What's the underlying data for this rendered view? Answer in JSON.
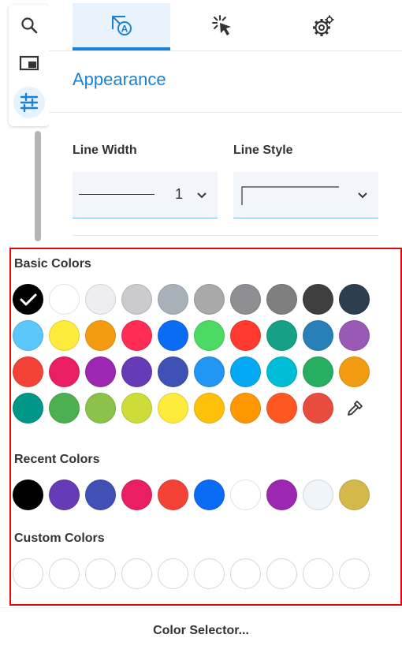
{
  "tabs": [
    {
      "name": "tab-appearance",
      "icon": "shape-text-icon",
      "active": true
    },
    {
      "name": "tab-interaction",
      "icon": "cursor-click-icon",
      "active": false
    },
    {
      "name": "tab-settings",
      "icon": "gear-icon",
      "active": false
    }
  ],
  "rail": [
    "search-icon",
    "panel-icon",
    "sliders-icon"
  ],
  "appearance": {
    "title": "Appearance",
    "line_width_label": "Line Width",
    "line_width_value": "1",
    "line_style_label": "Line Style"
  },
  "picker": {
    "basic_label": "Basic Colors",
    "recent_label": "Recent Colors",
    "custom_label": "Custom Colors",
    "basic_colors": [
      [
        "#000000",
        "#ffffff",
        "#eeeef2",
        "#cbcbcf",
        "#a9b1ba",
        "#a9a9a9",
        "#8e8e93",
        "#7f7f7f",
        "#3f3f3f",
        "#2c3e50"
      ],
      [
        "#5ac8fa",
        "#ffeb3b",
        "#f39c12",
        "#ff2d55",
        "#0a6cf5",
        "#4cd964",
        "#ff3b30",
        "#16a085",
        "#2980b9",
        "#9b59b6"
      ],
      [
        "#f44336",
        "#e91e63",
        "#9c27b0",
        "#673ab7",
        "#3f51b5",
        "#2196f3",
        "#03a9f4",
        "#00bcd4",
        "#27ae60",
        "#f39c12"
      ],
      [
        "#009688",
        "#4caf50",
        "#8bc34a",
        "#cddc39",
        "#ffeb3b",
        "#ffc107",
        "#ff9800",
        "#ff5722",
        "#e74c3c"
      ]
    ],
    "selected_basic": 0,
    "recent_colors": [
      "#000000",
      "#673ab7",
      "#3f51b5",
      "#e91e63",
      "#f44336",
      "#0a6cf5",
      "#ffffff",
      "#9c27b0",
      "#f0f5fa",
      "#d4b84a"
    ],
    "custom_slot_count": 10
  },
  "footer": {
    "label": "Color Selector..."
  }
}
